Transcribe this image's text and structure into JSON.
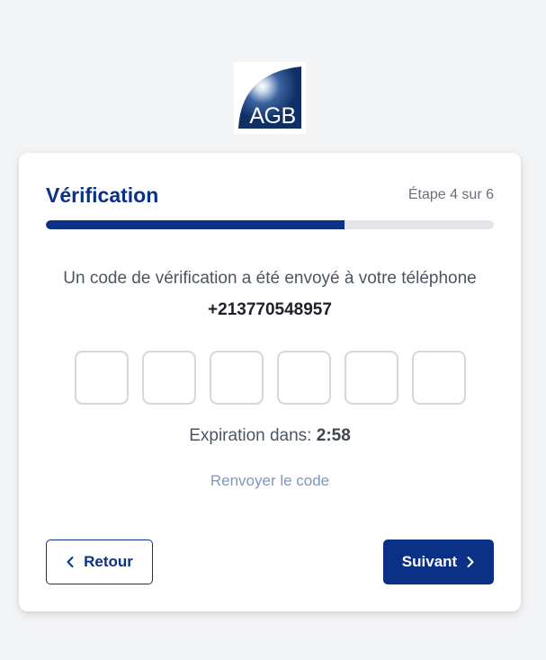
{
  "logo": {
    "text": "AGB"
  },
  "card": {
    "title": "Vérification",
    "step_label": "Étape 4 sur 6",
    "progress": 0.667
  },
  "message": "Un code de vérification a été envoyé à votre téléphone",
  "phone": "+213770548957",
  "code_inputs": [
    "",
    "",
    "",
    "",
    "",
    ""
  ],
  "expiry": {
    "label": "Expiration dans:",
    "time": "2:58"
  },
  "resend_label": "Renvoyer le code",
  "buttons": {
    "back_label": "Retour",
    "next_label": "Suivant"
  },
  "colors": {
    "primary": "#0a3185",
    "background": "#f3f4f6",
    "progress_track": "#e4e5e9",
    "link": "#7f96bd"
  }
}
